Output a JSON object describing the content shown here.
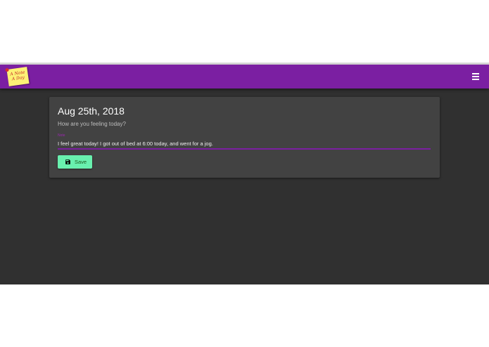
{
  "app": {
    "logo_line1": "A Note",
    "logo_line2": "A Day",
    "menu_icon": "hamburger-menu-icon"
  },
  "entry": {
    "date": "Aug 25th, 2018",
    "prompt": "How are you feeling today?",
    "field_label": "Note",
    "note_value": "I feel great today! I got out of bed at 6:00 today, and went for a jog.",
    "save_label": "Save",
    "save_icon": "floppy-disk-icon"
  },
  "colors": {
    "appbar": "#7b1fa2",
    "background": "#303030",
    "card": "#424242",
    "save_button": "#69f0ae",
    "input_underline": "#7b1fa2"
  }
}
